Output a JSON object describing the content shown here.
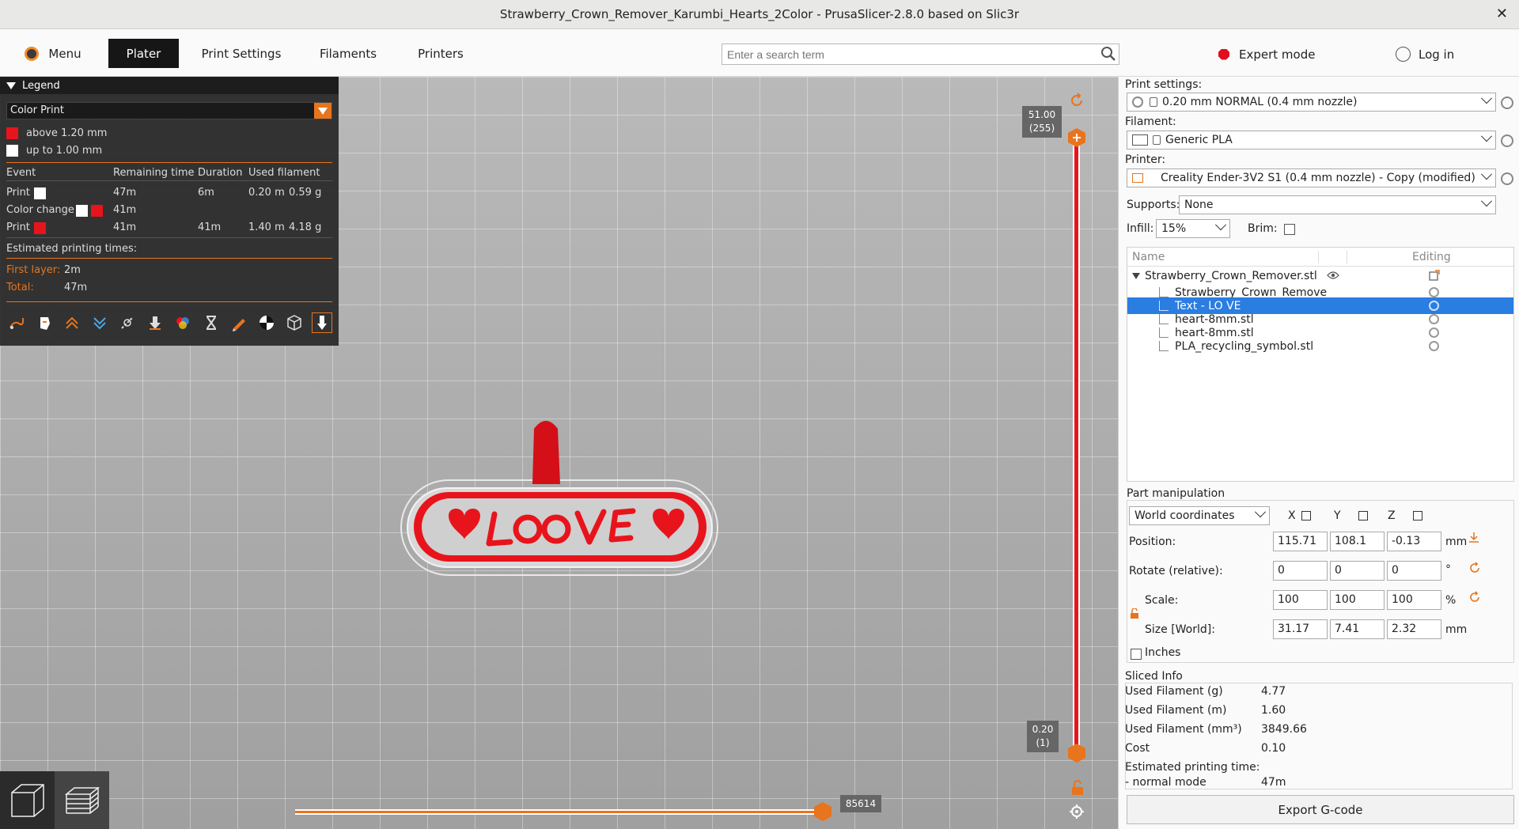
{
  "window": {
    "title": "Strawberry_Crown_Remover_Karumbi_Hearts_2Color - PrusaSlicer-2.8.0 based on Slic3r"
  },
  "toolbar": {
    "menu_label": "Menu",
    "tabs": [
      "Plater",
      "Print Settings",
      "Filaments",
      "Printers"
    ],
    "search_placeholder": "Enter a search term",
    "mode_label": "Expert mode",
    "login_label": "Log in"
  },
  "legend": {
    "title": "Legend",
    "view_type": "Color Print",
    "ranges": [
      {
        "label": "above 1.20 mm",
        "color": "#e8141c"
      },
      {
        "label": "up to 1.00 mm",
        "color": "#ffffff"
      }
    ],
    "columns": [
      "Event",
      "Remaining time",
      "Duration",
      "Used filament"
    ],
    "events": [
      {
        "event": "Print",
        "remaining": "47m",
        "duration": "6m",
        "length": "0.20 m",
        "weight": "0.59 g"
      },
      {
        "event": "Color change",
        "remaining": "41m",
        "duration": "",
        "length": "",
        "weight": ""
      },
      {
        "event": "Print",
        "remaining": "41m",
        "duration": "41m",
        "length": "1.40 m",
        "weight": "4.18 g"
      }
    ],
    "est_title": "Estimated printing times:",
    "first_layer_label": "First layer:",
    "first_layer_value": "2m",
    "total_label": "Total:",
    "total_value": "47m"
  },
  "vertical_slider": {
    "top_value": "51.00",
    "top_layer": "(255)",
    "bottom_value": "0.20",
    "bottom_layer": "(1)"
  },
  "horizontal_slider": {
    "value": "85614"
  },
  "sidebar": {
    "print_settings_label": "Print settings:",
    "print_settings_value": "0.20 mm NORMAL (0.4 mm nozzle)",
    "filament_label": "Filament:",
    "filament_value": "Generic PLA",
    "printer_label": "Printer:",
    "printer_value": "Creality Ender-3V2 S1 (0.4 mm nozzle) - Copy (modified)",
    "supports_label": "Supports:",
    "supports_value": "None",
    "infill_label": "Infill:",
    "infill_value": "15%",
    "brim_label": "Brim:",
    "list_col_name": "Name",
    "list_col_editing": "Editing",
    "objects": [
      {
        "name": "Strawberry_Crown_Remover.stl",
        "level": 0,
        "selected": false
      },
      {
        "name": "Strawberry_Crown_Remove",
        "level": 1,
        "selected": false
      },
      {
        "name": "Text - LO VE",
        "level": 1,
        "selected": true
      },
      {
        "name": "heart-8mm.stl",
        "level": 1,
        "selected": false
      },
      {
        "name": "heart-8mm.stl",
        "level": 1,
        "selected": false
      },
      {
        "name": "PLA_recycling_symbol.stl",
        "level": 1,
        "selected": false
      }
    ],
    "part_manipulation": {
      "title": "Part manipulation",
      "coords": "World coordinates",
      "axes": [
        "X",
        "Y",
        "Z"
      ],
      "position_label": "Position:",
      "position": [
        "115.71",
        "108.1",
        "-0.13"
      ],
      "position_unit": "mm",
      "rotate_label": "Rotate (relative):",
      "rotate": [
        "0",
        "0",
        "0"
      ],
      "rotate_unit": "°",
      "scale_label": "Scale:",
      "scale": [
        "100",
        "100",
        "100"
      ],
      "scale_unit": "%",
      "size_label": "Size [World]:",
      "size": [
        "31.17",
        "7.41",
        "2.32"
      ],
      "size_unit": "mm",
      "inches_label": "Inches"
    },
    "sliced_info": {
      "title": "Sliced Info",
      "rows": [
        {
          "label": "Used Filament (g)",
          "value": "4.77"
        },
        {
          "label": "Used Filament (m)",
          "value": "1.60"
        },
        {
          "label": "Used Filament (mm³)",
          "value": "3849.66"
        },
        {
          "label": "Cost",
          "value": "0.10"
        },
        {
          "label": "Estimated printing time:",
          "value": ""
        },
        {
          "label": "- normal mode",
          "value": "47m"
        }
      ]
    },
    "export_label": "Export G-code"
  },
  "colors": {
    "accent": "#e8741d",
    "selection": "#2a7de1",
    "model_red": "#e8141c"
  }
}
